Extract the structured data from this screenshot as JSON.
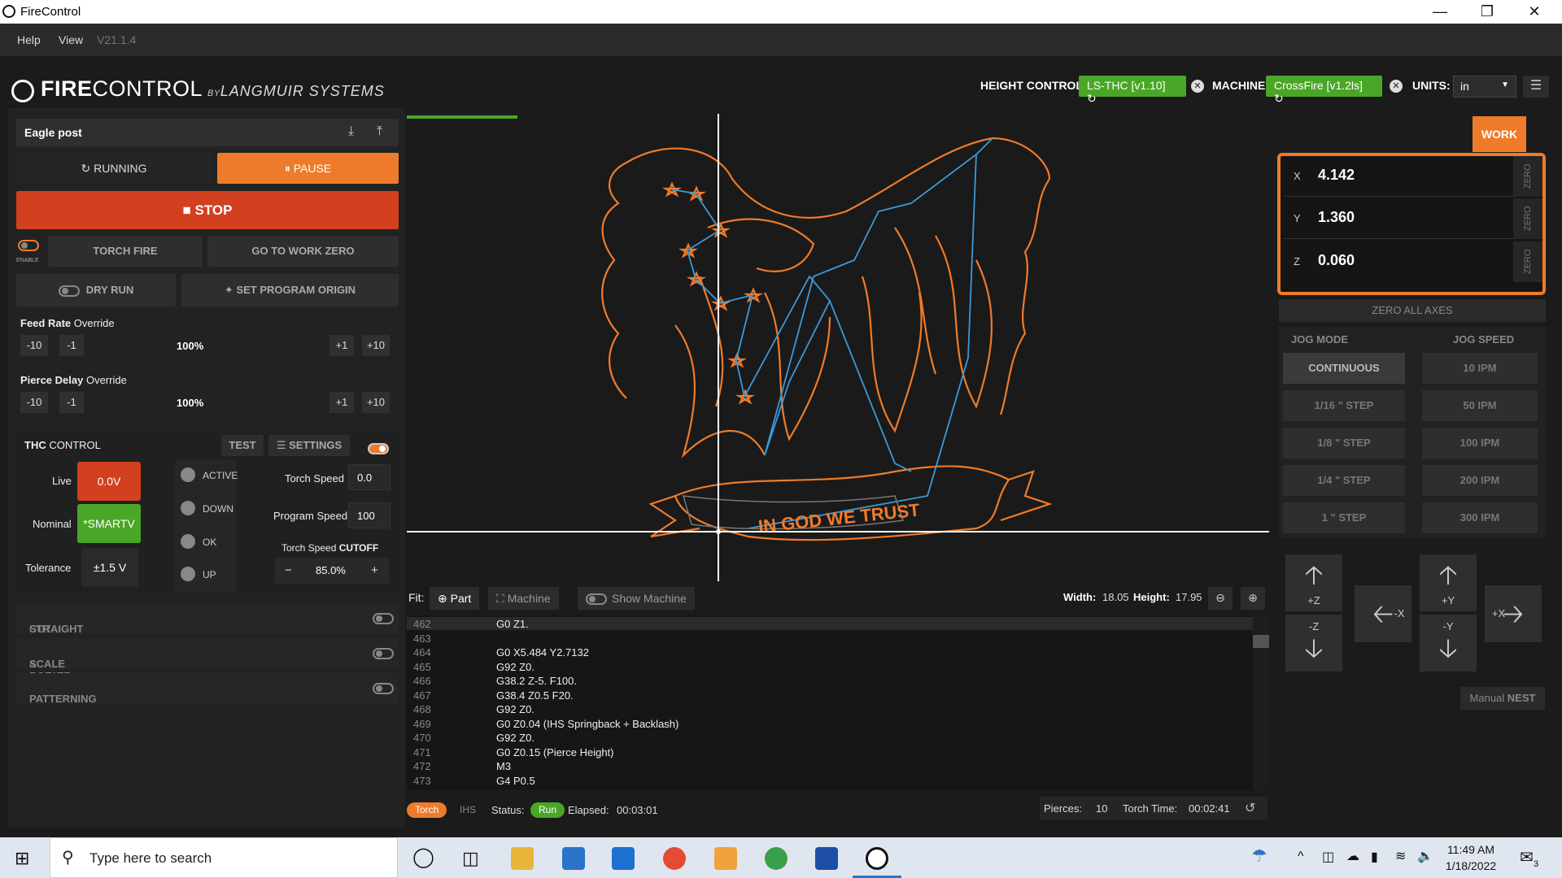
{
  "window": {
    "title": "FireControl"
  },
  "menu": {
    "items": [
      "Help",
      "View"
    ],
    "version": "V21.1.4"
  },
  "brand": {
    "fire": "FIRE",
    "control": "CONTROL",
    "by": "BY",
    "company": "LANGMUIR SYSTEMS"
  },
  "header": {
    "height_control_label": "HEIGHT CONTROL:",
    "height_control_value": "LS-THC  [v1.10]",
    "machine_label": "MACHINE",
    "machine_value": "CrossFire  [v1.2ls]",
    "units_label": "UNITS:",
    "units_value": "in"
  },
  "job": {
    "name": "Eagle post"
  },
  "controls": {
    "running": "RUNNING",
    "pause": "PAUSE",
    "stop": "STOP",
    "enable": "ENABLE",
    "torch_fire": "TORCH FIRE",
    "go_to_work_zero": "GO TO WORK ZERO",
    "dry_run": "DRY RUN",
    "set_program_origin": "SET PROGRAM ORIGIN"
  },
  "feed_rate": {
    "label": "Feed Rate",
    "suffix": "Override",
    "value": "100%",
    "btns": [
      "-10",
      "-1",
      "+1",
      "+10"
    ]
  },
  "pierce_delay": {
    "label": "Pierce Delay",
    "suffix": "Override",
    "value": "100%",
    "btns": [
      "-10",
      "-1",
      "+1",
      "+10"
    ]
  },
  "thc": {
    "title_a": "THC",
    "title_b": "CONTROL",
    "test": "TEST",
    "settings": "SETTINGS",
    "live_label": "Live",
    "live_value": "0.0V",
    "nominal_label": "Nominal",
    "nominal_value": "*SMARTV",
    "tolerance_label": "Tolerance",
    "tolerance_value": "±1.5  V",
    "states": [
      "ACTIVE",
      "DOWN",
      "OK",
      "UP"
    ],
    "torch_speed_label": "Torch Speed",
    "torch_speed_value": "0.0",
    "program_speed_label": "Program Speed",
    "program_speed_value": "100",
    "cutoff_label_a": "Torch Speed",
    "cutoff_label_b": "CUTOFF",
    "cutoff_value": "85.0%",
    "minus": "−",
    "plus": "+"
  },
  "sections": [
    {
      "a": "STRAIGHT",
      "b": "CUT"
    },
    {
      "a": "SCALE",
      "b": "&  ROTATE"
    },
    {
      "a": "PATTERNING",
      "b": ""
    }
  ],
  "design": {
    "banner_text": "IN GOD WE TRUST"
  },
  "fit": {
    "label": "Fit:",
    "part": "Part",
    "machine": "Machine",
    "show_machine": "Show Machine",
    "width_label": "Width:",
    "width_value": "18.05",
    "height_label": "Height:",
    "height_value": "17.95"
  },
  "gcode": [
    {
      "ln": "462",
      "tx": "G0 Z1."
    },
    {
      "ln": "463",
      "tx": ""
    },
    {
      "ln": "464",
      "tx": "G0 X5.484 Y2.7132"
    },
    {
      "ln": "465",
      "tx": "G92 Z0."
    },
    {
      "ln": "466",
      "tx": "G38.2 Z-5. F100."
    },
    {
      "ln": "467",
      "tx": "G38.4 Z0.5 F20."
    },
    {
      "ln": "468",
      "tx": "G92 Z0."
    },
    {
      "ln": "469",
      "tx": "G0 Z0.04 (IHS Springback + Backlash)"
    },
    {
      "ln": "470",
      "tx": "G92 Z0."
    },
    {
      "ln": "471",
      "tx": "G0 Z0.15 (Pierce Height)"
    },
    {
      "ln": "472",
      "tx": "M3"
    },
    {
      "ln": "473",
      "tx": "G4 P0.5"
    }
  ],
  "status": {
    "torch": "Torch",
    "ihs": "IHS",
    "status_label": "Status:",
    "status_value": "Run",
    "elapsed_label": "Elapsed:",
    "elapsed_value": "00:03:01",
    "pierces_label": "Pierces:",
    "pierces_value": "10",
    "torch_time_label": "Torch Time:",
    "torch_time_value": "00:02:41"
  },
  "dro": {
    "tab": "WORK",
    "axes": [
      {
        "axis": "X",
        "value": "4.142"
      },
      {
        "axis": "Y",
        "value": "1.360"
      },
      {
        "axis": "Z",
        "value": "0.060"
      }
    ],
    "zero": "ZERO",
    "zero_all": "ZERO ALL AXES"
  },
  "jog": {
    "mode_label": "JOG MODE",
    "speed_label": "JOG SPEED",
    "modes": [
      "CONTINUOUS",
      "1/16 \" STEP",
      "1/8 \" STEP",
      "1/4 \" STEP",
      "1 \" STEP"
    ],
    "speeds": [
      "10 IPM",
      "50 IPM",
      "100 IPM",
      "200 IPM",
      "300 IPM"
    ],
    "arrows": {
      "zp": "+Z",
      "zm": "-Z",
      "xm": "-X",
      "yp": "+Y",
      "ym": "-Y",
      "xp": "+X"
    },
    "nest_a": "Manual",
    "nest_b": "NEST"
  },
  "taskbar": {
    "search": "Type here to search",
    "time": "11:49 AM",
    "date": "1/18/2022",
    "notif": "3"
  },
  "colors": {
    "accent": "#ee7b2a",
    "green": "#4aa626",
    "stop": "#d2401f",
    "path": "#ee7b2a",
    "rapid": "#3b9ad9"
  }
}
